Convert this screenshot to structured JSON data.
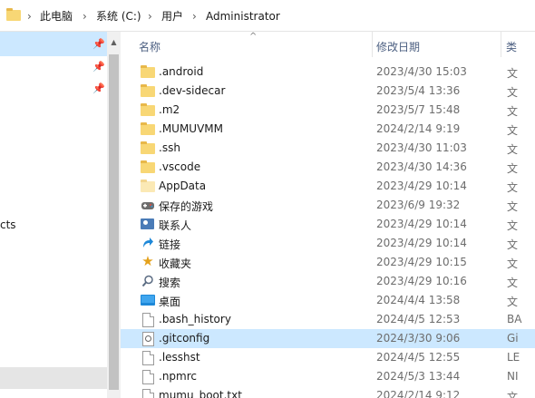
{
  "breadcrumb": {
    "items": [
      "此电脑",
      "系统 (C:)",
      "用户",
      "Administrator"
    ],
    "separator": "›"
  },
  "columns": {
    "name": "名称",
    "date": "修改日期",
    "type": "类"
  },
  "nav": {
    "partial_label": "cts"
  },
  "files": [
    {
      "name": ".android",
      "date": "2023/4/30 15:03",
      "type": "文",
      "icon": "folder-icon"
    },
    {
      "name": ".dev-sidecar",
      "date": "2023/5/4 13:36",
      "type": "文",
      "icon": "folder-icon"
    },
    {
      "name": ".m2",
      "date": "2023/5/7 15:48",
      "type": "文",
      "icon": "folder-icon"
    },
    {
      "name": ".MUMUVMM",
      "date": "2024/2/14 9:19",
      "type": "文",
      "icon": "folder-icon"
    },
    {
      "name": ".ssh",
      "date": "2023/4/30 11:03",
      "type": "文",
      "icon": "folder-icon"
    },
    {
      "name": ".vscode",
      "date": "2023/4/30 14:36",
      "type": "文",
      "icon": "folder-icon"
    },
    {
      "name": "AppData",
      "date": "2023/4/29 10:14",
      "type": "文",
      "icon": "hidden-folder-icon"
    },
    {
      "name": "保存的游戏",
      "date": "2023/6/9 19:32",
      "type": "文",
      "icon": "saved-games-icon"
    },
    {
      "name": "联系人",
      "date": "2023/4/29 10:14",
      "type": "文",
      "icon": "contacts-icon"
    },
    {
      "name": "链接",
      "date": "2023/4/29 10:14",
      "type": "文",
      "icon": "links-icon"
    },
    {
      "name": "收藏夹",
      "date": "2023/4/29 10:15",
      "type": "文",
      "icon": "favorites-icon"
    },
    {
      "name": "搜索",
      "date": "2023/4/29 10:16",
      "type": "文",
      "icon": "searches-icon"
    },
    {
      "name": "桌面",
      "date": "2024/4/4 13:58",
      "type": "文",
      "icon": "desktop-icon"
    },
    {
      "name": ".bash_history",
      "date": "2024/4/5 12:53",
      "type": "BA",
      "icon": "file-icon"
    },
    {
      "name": ".gitconfig",
      "date": "2024/3/30 9:06",
      "type": "Gi",
      "icon": "config-file-icon",
      "selected": true
    },
    {
      "name": ".lesshst",
      "date": "2024/4/5 12:55",
      "type": "LE",
      "icon": "file-icon"
    },
    {
      "name": ".npmrc",
      "date": "2024/5/3 13:44",
      "type": "NI",
      "icon": "file-icon"
    },
    {
      "name": "mumu_boot.txt",
      "date": "2024/2/14 9:12",
      "type": "文",
      "icon": "text-file-icon"
    }
  ]
}
